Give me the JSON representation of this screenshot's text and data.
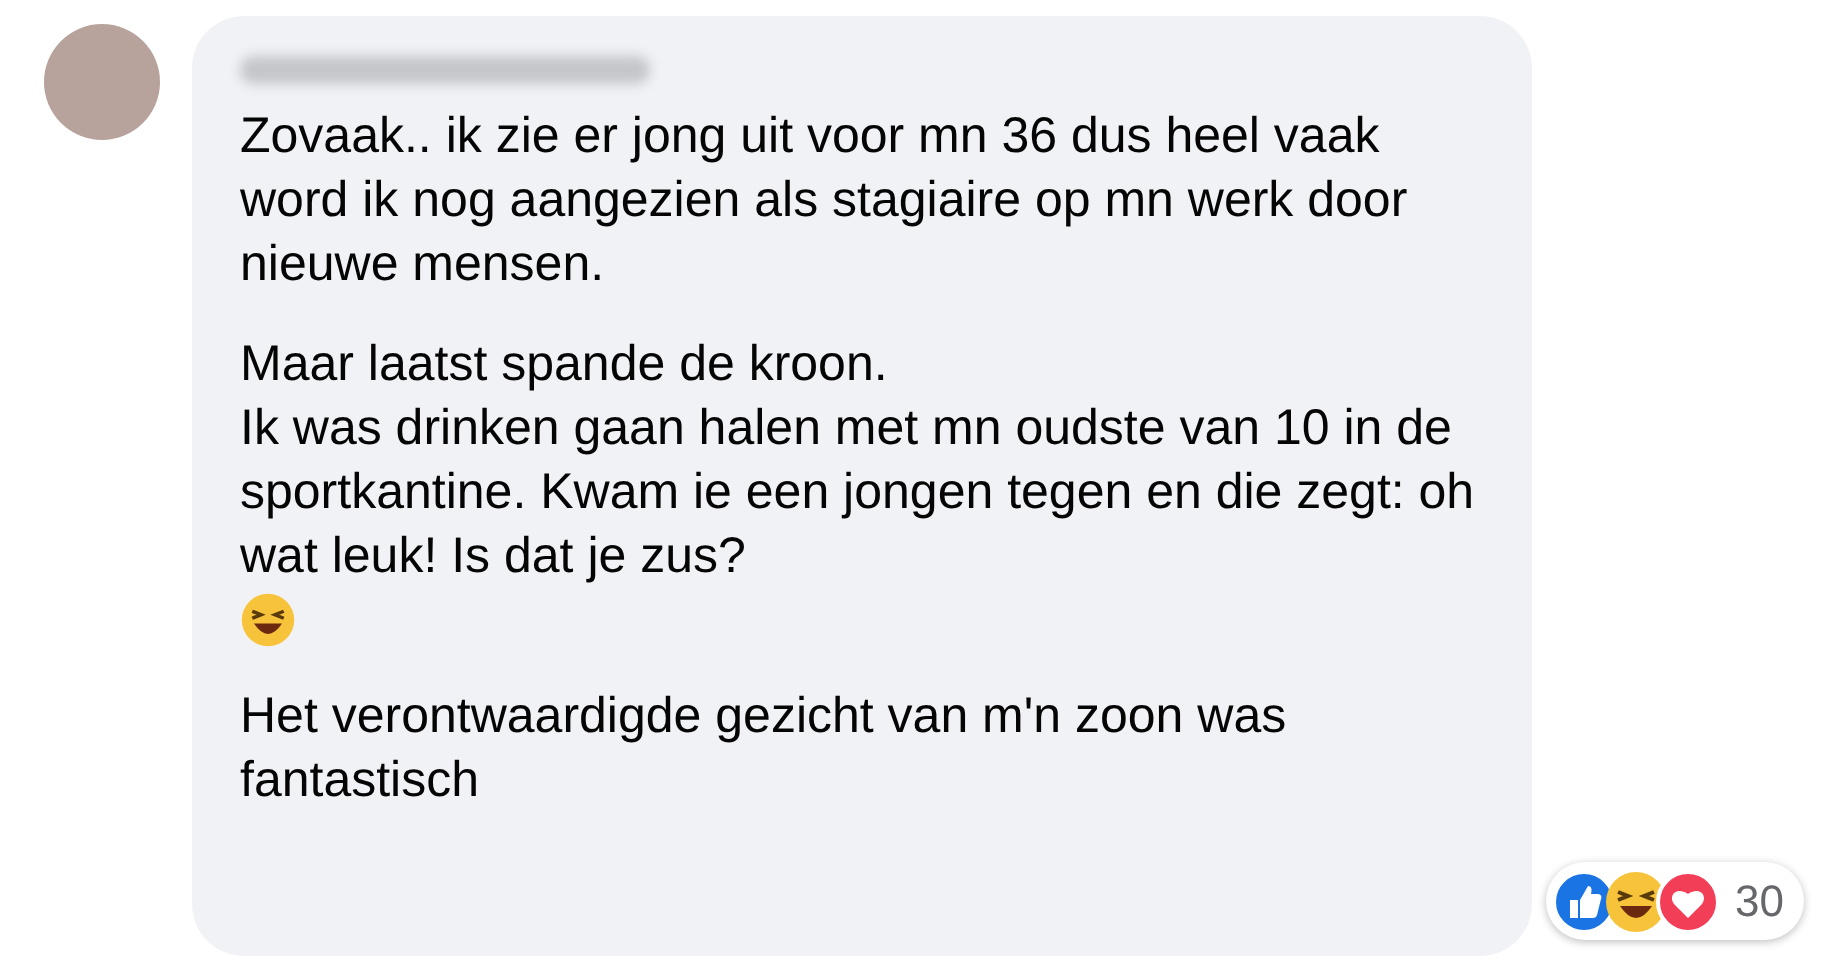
{
  "comment": {
    "paragraphs": [
      {
        "text": "Zovaak.. ik zie er jong uit voor mn 36 dus heel vaak word ik nog aangezien als stagiaire op mn werk door nieuwe mensen.",
        "kind": "text"
      },
      {
        "text": "Maar laatst spande de kroon.\nIk was drinken gaan halen met mn oudste van 10 in de sportkantine. Kwam ie een jongen tegen en die zegt: oh wat leuk! Is dat je zus?",
        "kind": "text"
      },
      {
        "kind": "emoji"
      },
      {
        "text": "Het verontwaardigde gezicht van m'n zoon was fantastisch",
        "kind": "text"
      }
    ],
    "reactions": {
      "count": "30"
    }
  }
}
